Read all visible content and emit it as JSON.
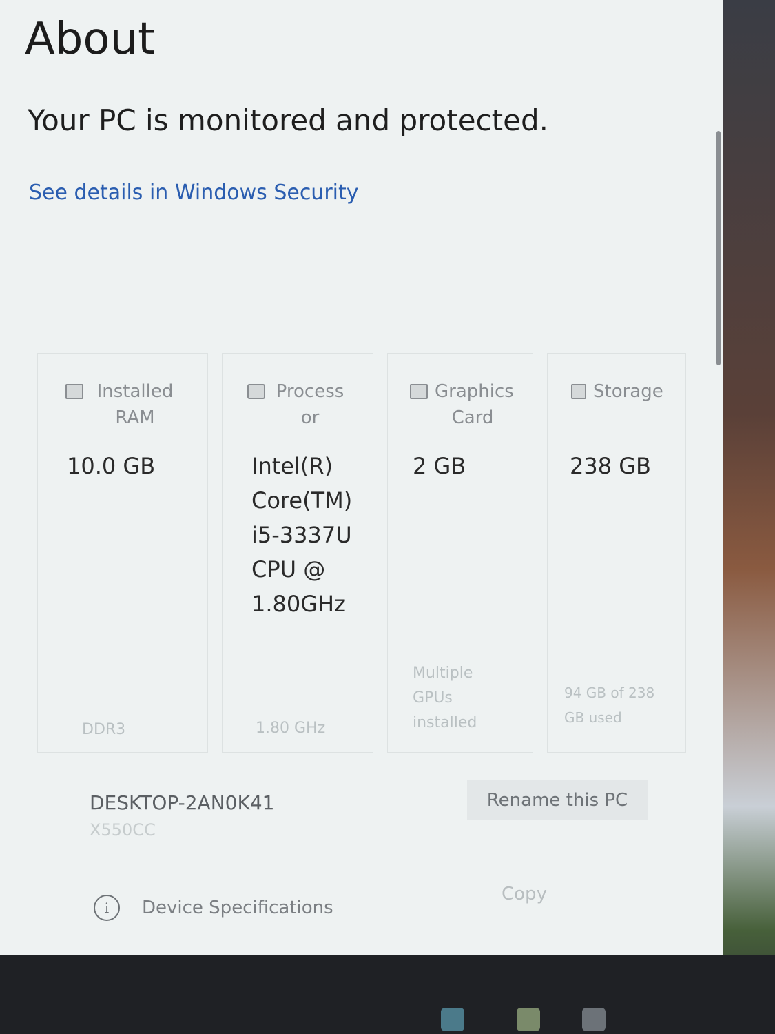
{
  "page": {
    "title": "About",
    "security_headline": "Your PC is monitored and protected.",
    "security_link": "See details in Windows Security"
  },
  "specs": [
    {
      "icon": "ram-icon",
      "label": "Installed RAM",
      "value": "10.0 GB",
      "sub": "DDR3"
    },
    {
      "icon": "processor-icon",
      "label": "Processor",
      "value": "Intel(R) Core(TM) i5-3337U CPU @ 1.80GHz",
      "sub": "1.80 GHz"
    },
    {
      "icon": "graphics-card-icon",
      "label": "Graphics Card",
      "value": "2 GB",
      "sub": "Multiple GPUs installed"
    },
    {
      "icon": "storage-icon",
      "label": "Storage",
      "value": "238 GB",
      "sub": "94 GB of 238 GB used"
    }
  ],
  "device": {
    "name": "DESKTOP-2AN0K41",
    "model": "X550CC",
    "rename_button": "Rename this PC"
  },
  "specifications": {
    "label": "Device Specifications",
    "info_glyph": "i",
    "copy_button": "Copy"
  }
}
